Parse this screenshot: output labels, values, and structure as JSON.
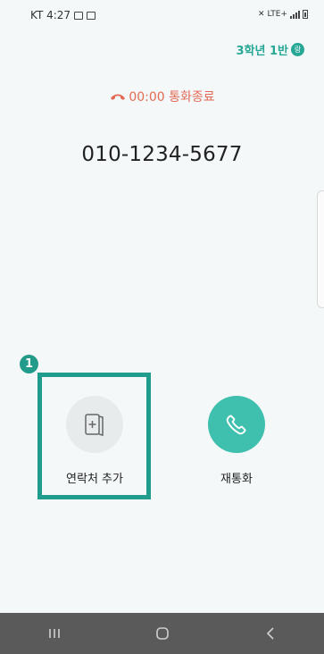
{
  "status_bar": {
    "carrier_time": "KT 4:27",
    "network": "LTE+"
  },
  "header": {
    "class_name": "3학년 1반",
    "badge": "랑"
  },
  "call": {
    "status_text": "00:00 통화종료",
    "phone_number": "010-1234-5677"
  },
  "guide": {
    "step_number": "1"
  },
  "actions": {
    "add_contact": "연락처 추가",
    "recall": "재통화"
  },
  "nav": {
    "recents": "|||",
    "home": "○",
    "back": "<"
  },
  "colors": {
    "accent": "#27a896",
    "call_end": "#e36a55",
    "navbar": "#5a5a5a"
  },
  "icons": {
    "call_end": "phone-hangup-icon",
    "add_contact": "add-contact-icon",
    "recall": "phone-icon"
  }
}
